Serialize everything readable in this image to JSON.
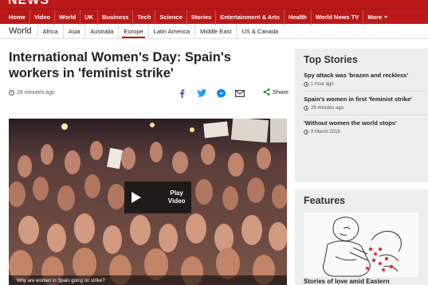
{
  "brand": "NEWS",
  "main_nav": [
    "Home",
    "Video",
    "World",
    "UK",
    "Business",
    "Tech",
    "Science",
    "Stories",
    "Entertainment & Arts",
    "Health",
    "World News TV",
    "More"
  ],
  "sub_nav": {
    "section": "World",
    "items": [
      "Africa",
      "Asia",
      "Australia",
      "Europe",
      "Latin America",
      "Middle East",
      "US & Canada"
    ],
    "active": "Europe"
  },
  "article": {
    "headline": "International Women's Day: Spain's workers in 'feminist strike'",
    "time": "29 minutes ago",
    "share_label": "Share"
  },
  "video": {
    "play_label": "Play Video",
    "caption": "Why are women in Spain going on strike?"
  },
  "top_stories": {
    "title": "Top Stories",
    "items": [
      {
        "headline": "Spy attack was 'brazen and reckless'",
        "time": "1 hour ago"
      },
      {
        "headline": "Spain's women in first 'feminist strike'",
        "time": "29 minutes ago"
      },
      {
        "headline": "'Without women the world stops'",
        "time": "8 March 2018"
      }
    ]
  },
  "features": {
    "title": "Features",
    "headline": "Stories of love amid Eastern"
  },
  "colors": {
    "brand_red": "#bb1919",
    "panel_grey": "#eeeeee"
  },
  "icons": [
    "clock-icon",
    "facebook-icon",
    "twitter-icon",
    "messenger-icon",
    "email-icon",
    "share-icon",
    "play-icon"
  ]
}
